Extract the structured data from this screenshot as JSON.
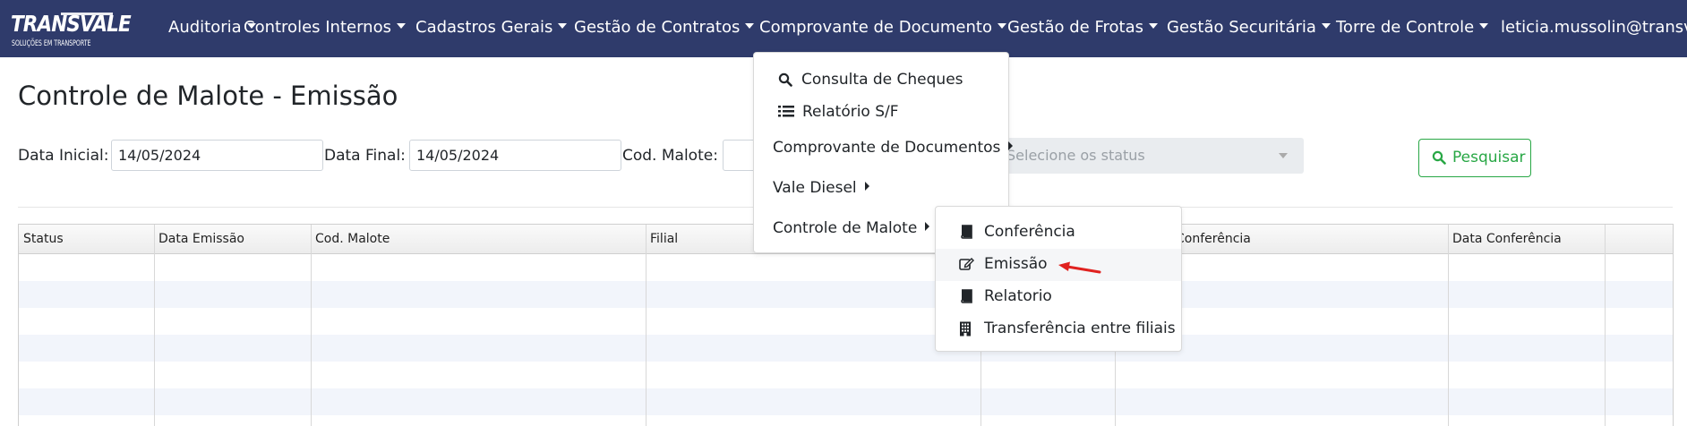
{
  "navbar": {
    "logo": {
      "main": "TRANSVALE",
      "sub": "SOLUÇÕES EM TRANSPORTE"
    },
    "items": [
      {
        "label": "Auditoria"
      },
      {
        "label": "Controles Internos"
      },
      {
        "label": "Cadastros Gerais"
      },
      {
        "label": "Gestão de Contratos"
      },
      {
        "label": "Comprovante de Documento"
      },
      {
        "label": "Gestão de Frotas"
      },
      {
        "label": "Gestão Securitária"
      },
      {
        "label": "Torre de Controle"
      }
    ],
    "user": "leticia.mussolin@transvale"
  },
  "page": {
    "title": "Controle de Malote - Emissão"
  },
  "filters": {
    "data_inicial_label": "Data Inicial:",
    "data_inicial_value": "14/05/2024",
    "data_final_label": "Data Final:",
    "data_final_value": "14/05/2024",
    "cod_malote_label": "Cod. Malote:",
    "status_placeholder": "Selecione os status",
    "search_label": "Pesquisar"
  },
  "table": {
    "columns": [
      "Status",
      "Data Emissão",
      "Cod. Malote",
      "Filial",
      "",
      "Conferência",
      "Data Conferência",
      ""
    ]
  },
  "dropdown": {
    "items": [
      {
        "label": "Consulta de Cheques",
        "icon": "search-icon"
      },
      {
        "label": "Relatório S/F",
        "icon": "list-icon"
      },
      {
        "label": "Comprovante de Documentos",
        "submenu": true
      },
      {
        "label": "Vale Diesel",
        "submenu": true
      },
      {
        "label": "Controle de Malote",
        "submenu": true
      }
    ]
  },
  "submenu": {
    "items": [
      {
        "label": "Conferência",
        "icon": "book-icon"
      },
      {
        "label": "Emissão",
        "icon": "edit-icon",
        "active": true
      },
      {
        "label": "Relatorio",
        "icon": "book-icon"
      },
      {
        "label": "Transferência entre filiais",
        "icon": "building-icon"
      }
    ]
  },
  "colors": {
    "navbar": "#2f3b6b",
    "accent_green": "#28a745",
    "annotation_arrow": "#e0211f"
  }
}
